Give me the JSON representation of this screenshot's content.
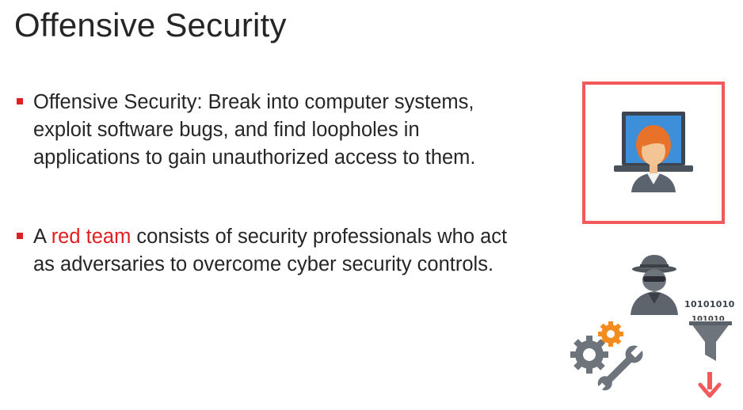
{
  "slide": {
    "title": "Offensive Security",
    "bullets": [
      {
        "text": "Offensive Security: Break into computer systems, exploit software bugs, and find loopholes in applications to gain unauthorized access to them."
      },
      {
        "prefix": "A ",
        "highlight": "red team",
        "suffix": " consists of security professionals who act as adversaries to overcome cyber security controls."
      }
    ]
  },
  "illustrations": {
    "hacker_laptop_icon": "laptop-with-person-icon",
    "spy_icon": "hacker-spy-icon",
    "binary_top": "10101010",
    "binary_bottom": "101010",
    "funnel_icon": "data-funnel-icon",
    "gears_icon": "gears-wrench-icon",
    "arrow_icon": "down-arrow-icon",
    "colors": {
      "accent_red": "#e02020",
      "frame_red": "#f05a5a",
      "screen_blue": "#3c8fd8",
      "hair_orange": "#e8722a",
      "gear_orange": "#f28c1e",
      "gray": "#6e747c"
    }
  }
}
